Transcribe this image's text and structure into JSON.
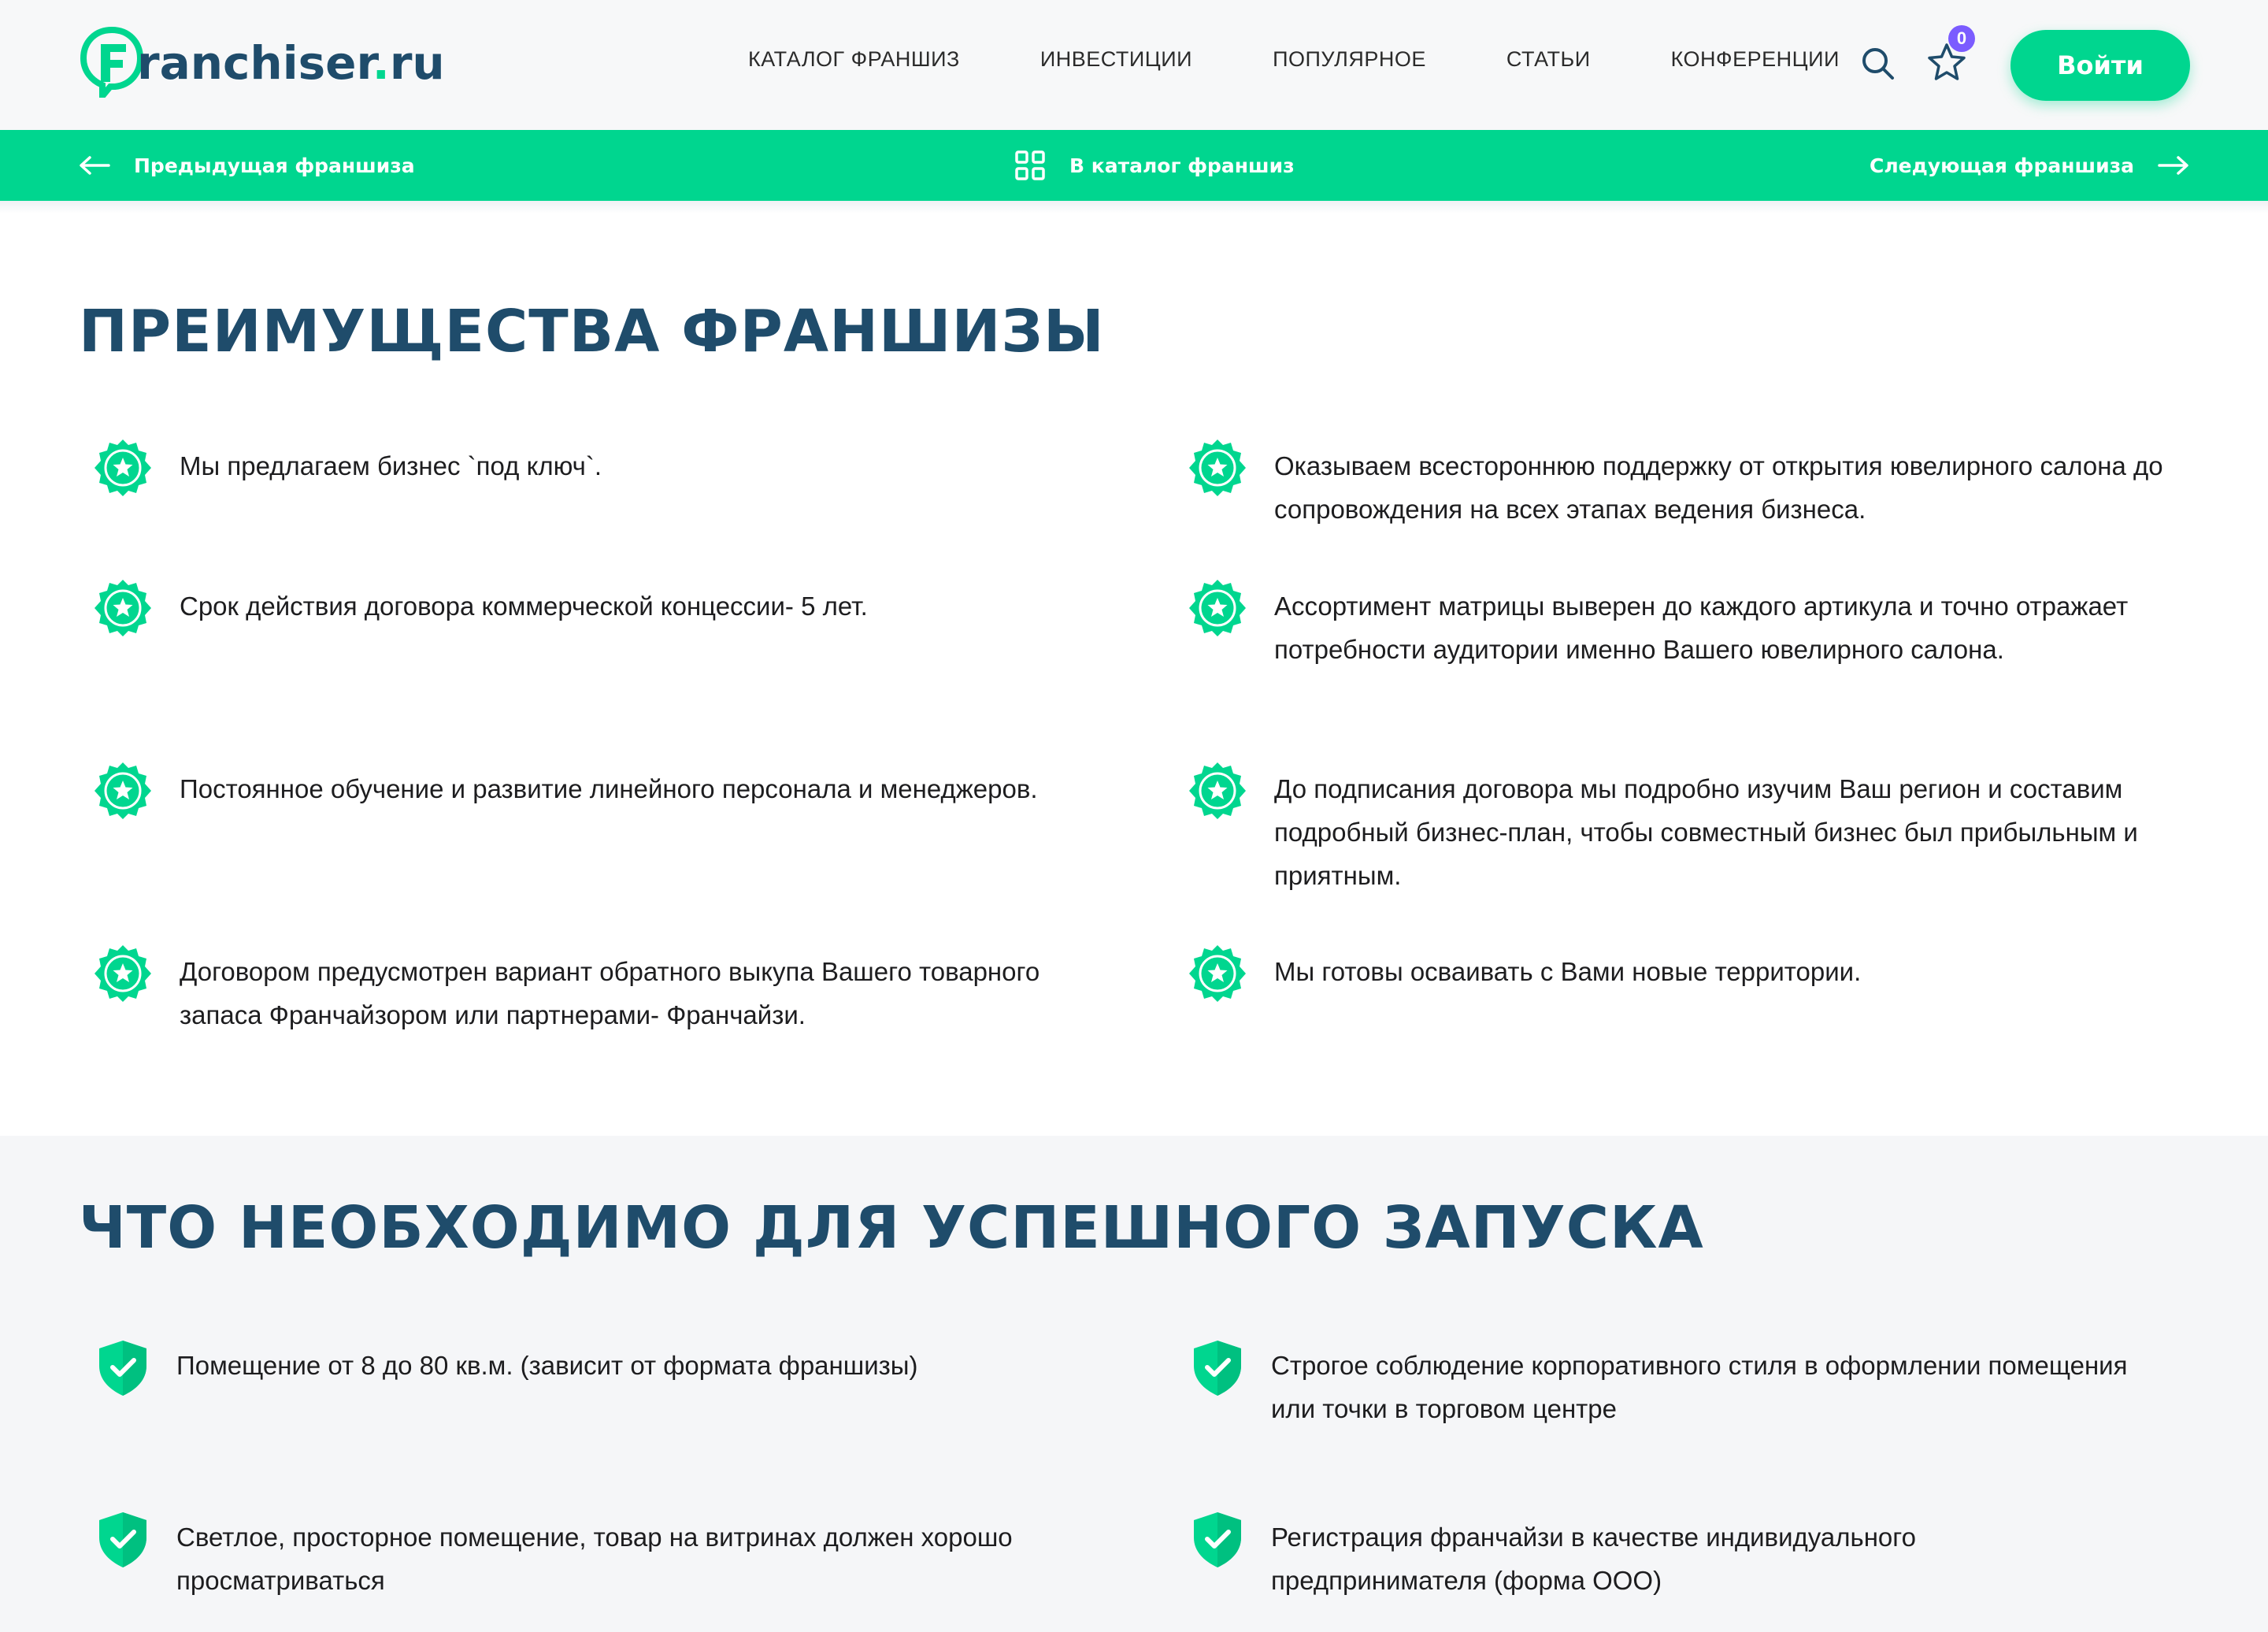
{
  "header": {
    "logo_text": "ranchiser",
    "logo_dot": ".",
    "logo_tld": "ru",
    "nav": [
      "КАТАЛОГ ФРАНШИЗ",
      "ИНВЕСТИЦИИ",
      "ПОПУЛЯРНОЕ",
      "СТАТЬИ",
      "КОНФЕРЕНЦИИ"
    ],
    "favorites_count": "0",
    "login_label": "Войти"
  },
  "greenbar": {
    "prev_label": "Предыдущая франшиза",
    "catalog_label": "В каталог франшиз",
    "next_label": "Следующая франшиза"
  },
  "advantages": {
    "title": "ПРЕИМУЩЕСТВА ФРАНШИЗЫ",
    "items": [
      "Мы предлагаем бизнес `под ключ`.",
      "Оказываем всестороннюю поддержку от открытия ювелирного салона до сопровождения на всех этапах ведения бизнеса.",
      "Срок действия договора коммерческой концессии- 5 лет.",
      "Ассортимент матрицы выверен до каждого артикула и точно отражает потребности аудитории именно Вашего ювелирного салона.",
      "Постоянное обучение и развитие линейного персонала и менеджеров.",
      "До подписания договора мы подробно изучим Ваш регион и составим подробный бизнес-план, чтобы совместный бизнес был прибыльным и приятным.",
      "Договором предусмотрен вариант обратного выкупа Вашего товарного запаса Франчайзором или партнерами- Франчайзи.",
      "Мы готовы осваивать с Вами новые территории."
    ]
  },
  "requirements": {
    "title": "ЧТО НЕОБХОДИМО ДЛЯ УСПЕШНОГО ЗАПУСКА",
    "items": [
      "Помещение от 8 до 80 кв.м. (зависит от формата франшизы)",
      "Строгое соблюдение корпоративного стиля в оформлении помещения или точки в торговом центре",
      "Светлое, просторное помещение, товар на витринах должен хорошо просматриваться",
      "Регистрация франчайзи в качестве индивидуального предпринимателя (форма ООО)"
    ]
  },
  "colors": {
    "accent": "#00d68f",
    "heading": "#1f4c6b",
    "badge": "#7b5cff"
  },
  "icons": {
    "advantage": "star-badge-icon",
    "requirement": "shield-check-icon"
  }
}
